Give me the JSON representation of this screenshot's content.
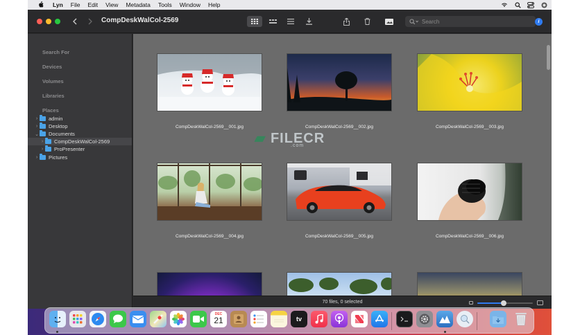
{
  "menubar": {
    "apple": "",
    "app": "Lyn",
    "items": [
      "File",
      "Edit",
      "View",
      "Metadata",
      "Tools",
      "Window",
      "Help"
    ],
    "icons": [
      "wifi-icon",
      "search-icon",
      "control-center-icon",
      "siri-icon"
    ]
  },
  "window": {
    "title": "CompDeskWalCol-2569",
    "search_placeholder": "Search",
    "info_label": "i"
  },
  "sidebar": {
    "sections": [
      "Search For",
      "Devices",
      "Volumes",
      "Libraries",
      "Places"
    ],
    "tree": [
      {
        "label": "admin",
        "chev": "›",
        "indent": 0,
        "selected": false
      },
      {
        "label": "Desktop",
        "chev": "›",
        "indent": 0,
        "selected": false
      },
      {
        "label": "Documents",
        "chev": "⌄",
        "indent": 0,
        "selected": false
      },
      {
        "label": "CompDeskWalCol-2569",
        "chev": "›",
        "indent": 1,
        "selected": true
      },
      {
        "label": "ProPresenter",
        "chev": "›",
        "indent": 1,
        "selected": false
      },
      {
        "label": "Pictures",
        "chev": "›",
        "indent": 0,
        "selected": false
      }
    ]
  },
  "thumbnails": [
    {
      "caption": "CompDeskWalCol-2569__001.jpg",
      "scene": "snowmen"
    },
    {
      "caption": "CompDeskWalCol-2569__002.jpg",
      "scene": "sunset-tree"
    },
    {
      "caption": "CompDeskWalCol-2569__003.jpg",
      "scene": "yellow-flower"
    },
    {
      "caption": "CompDeskWalCol-2569__004.jpg",
      "scene": "window-girl"
    },
    {
      "caption": "CompDeskWalCol-2569__005.jpg",
      "scene": "red-car"
    },
    {
      "caption": "CompDeskWalCol-2569__006.jpg",
      "scene": "camera-lens"
    },
    {
      "caption": "",
      "scene": "neon-sun"
    },
    {
      "caption": "",
      "scene": "forest-sky"
    },
    {
      "caption": "",
      "scene": "golden-sea"
    }
  ],
  "watermark": {
    "text": "FILECR",
    "sub": ".com"
  },
  "status": {
    "text": "70 files, 0 selected",
    "zoom_level": 0.48
  },
  "dock": {
    "apps": [
      "Finder",
      "Launchpad",
      "Safari",
      "Messages",
      "Mail",
      "Maps",
      "Photos",
      "FaceTime",
      "Calendar",
      "Contacts",
      "Reminders",
      "Notes",
      "TV",
      "Music",
      "Podcasts",
      "News",
      "App Store",
      "Terminal",
      "System Preferences",
      "Lyn",
      "Preview",
      "Downloads",
      "Trash"
    ],
    "calendar_month": "DEC",
    "calendar_day": "21",
    "tv_label": "tv"
  }
}
